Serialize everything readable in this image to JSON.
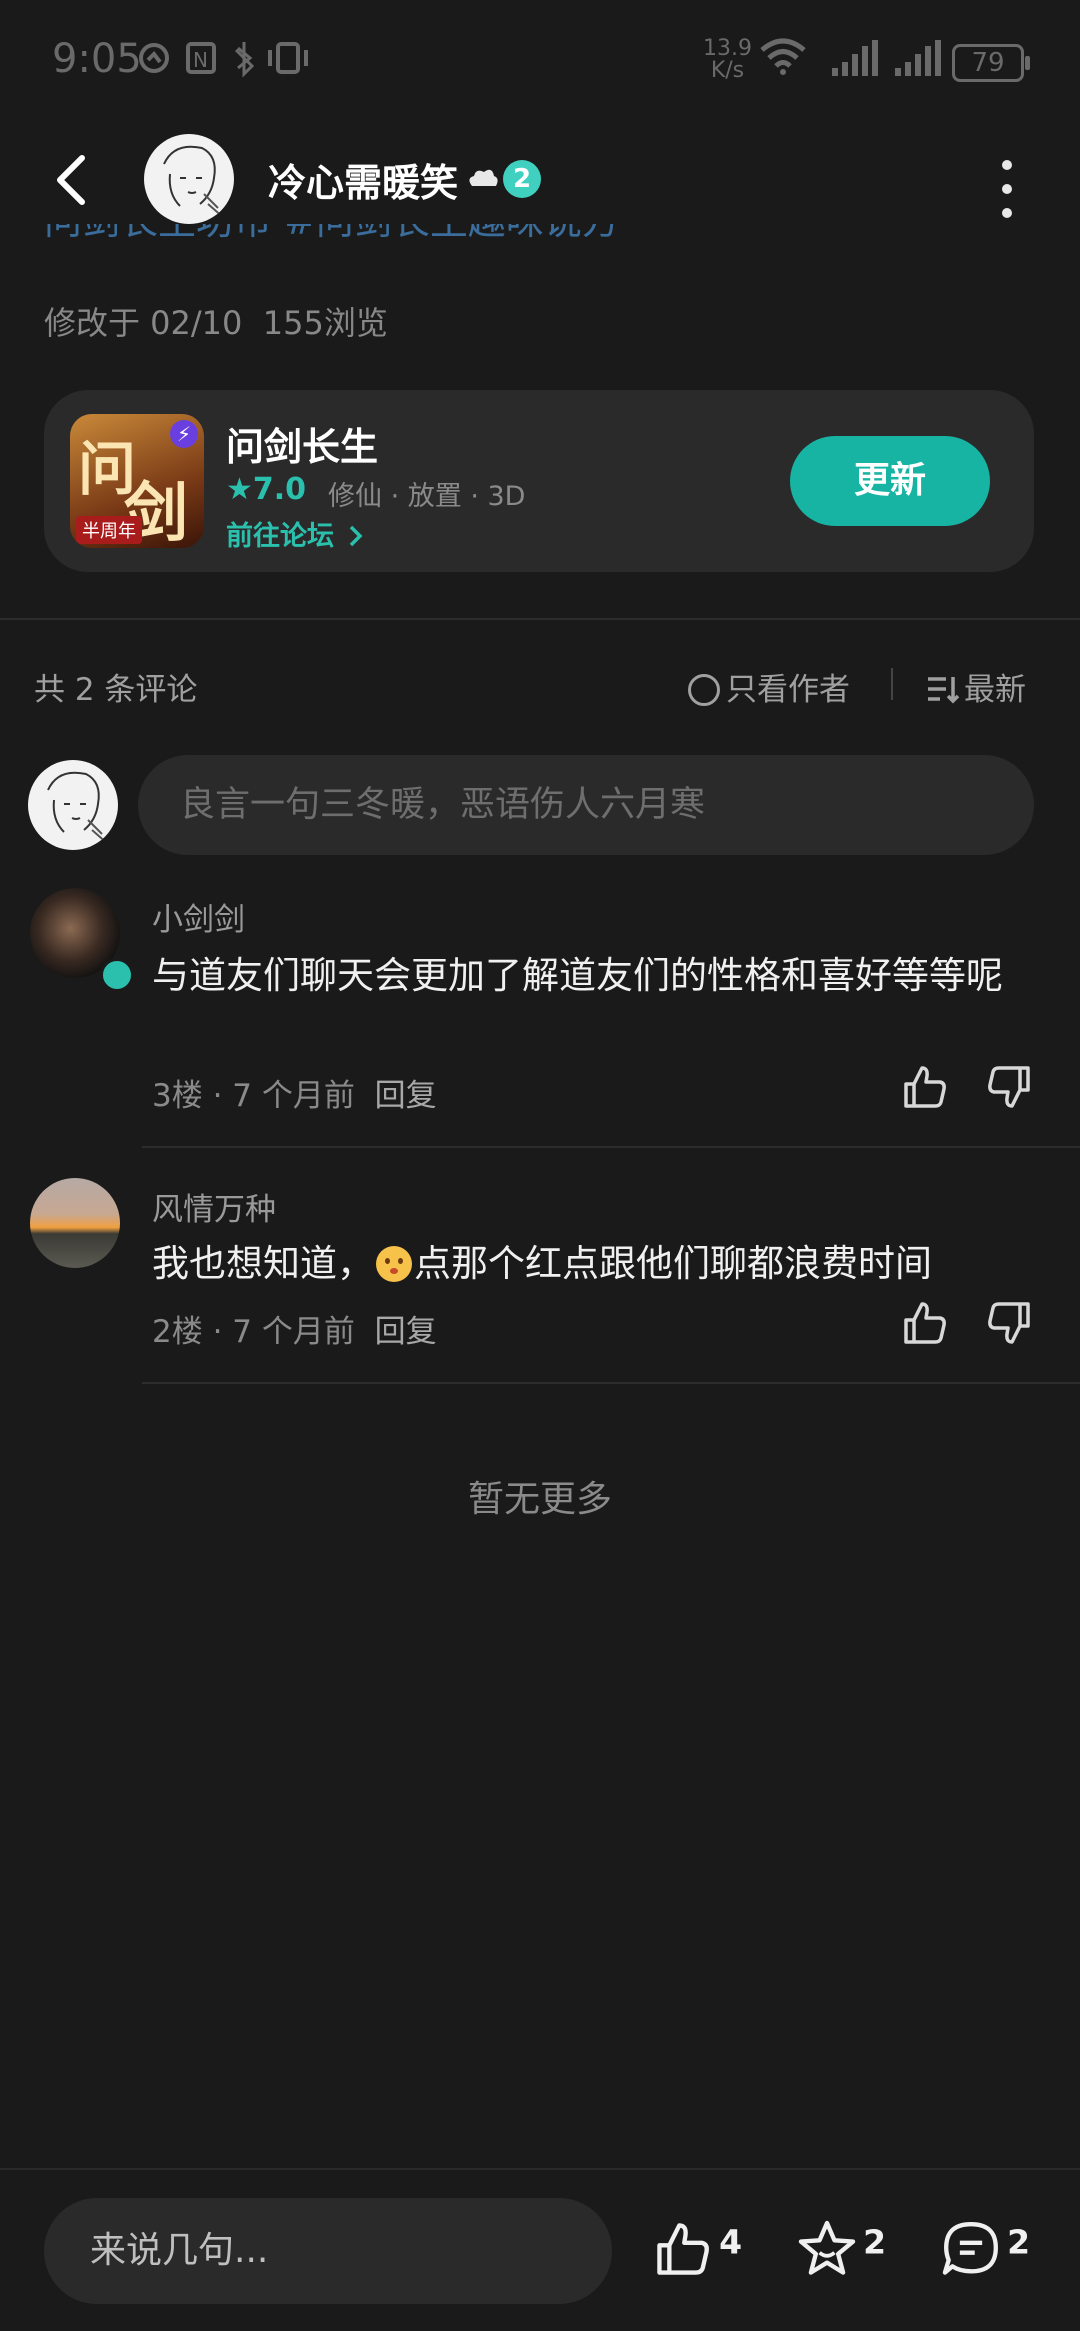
{
  "status_bar": {
    "time": "9:05",
    "net_speed_value": "13.9",
    "net_speed_unit": "K/s",
    "battery": "79"
  },
  "header": {
    "username": "冷心需暖笑",
    "level": "2"
  },
  "post": {
    "tags_partial": "问剑长生坊市 #问剑长生趣味说方",
    "modified": "修改于 02/10",
    "views": "155浏览"
  },
  "game_card": {
    "icon_text_1": "问",
    "icon_text_2": "剑",
    "icon_badge": "半周年",
    "name": "问剑长生",
    "rating": "7.0",
    "tags": "修仙 · 放置 · 3D",
    "forum_link": "前往论坛",
    "update_label": "更新"
  },
  "comments_header": {
    "count": "共 2 条评论",
    "author_only": "只看作者",
    "sort": "最新"
  },
  "comment_input": {
    "placeholder": "良言一句三冬暖，恶语伤人六月寒"
  },
  "comments": [
    {
      "name": "小剑剑",
      "text": "与道友们聊天会更加了解道友们的性格和喜好等等呢",
      "floor": "3楼",
      "time": "7 个月前",
      "reply": "回复"
    },
    {
      "name": "风情万种",
      "text_before": "我也想知道，",
      "text_after": "点那个红点跟他们聊都浪费时间",
      "floor": "2楼",
      "time": "7 个月前",
      "reply": "回复"
    }
  ],
  "no_more": "暂无更多",
  "bottom_bar": {
    "say_placeholder": "来说几句...",
    "likes": "4",
    "favorites": "2",
    "comments": "2"
  },
  "colors": {
    "background": "#1a1a1a",
    "accent": "#17b3a3",
    "card": "#2a2a2a"
  }
}
